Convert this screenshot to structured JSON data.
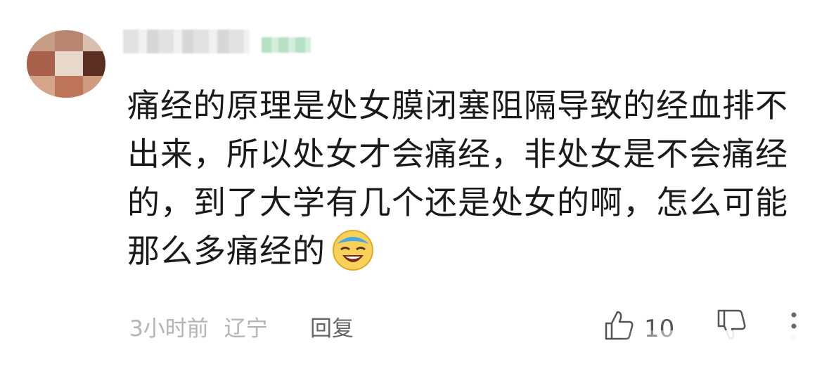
{
  "comment": {
    "text": "痛经的原理是处女膜闭塞阻隔导致的经血排不出来，所以处女才会痛经，非处女是不会痛经的，到了大学有几个还是处女的啊，怎么可能那么多痛经的",
    "emoji": "laughing-face-emoji"
  },
  "meta": {
    "time": "3小时前",
    "location": "辽宁",
    "reply_label": "回复"
  },
  "actions": {
    "like_count": "10",
    "like_icon": "thumbs-up-icon",
    "dislike_icon": "thumbs-down-icon",
    "more_icon": "more-vertical-icon"
  },
  "colors": {
    "text": "#1a1a1a",
    "meta": "#b4b4b4",
    "reply": "#666666"
  }
}
